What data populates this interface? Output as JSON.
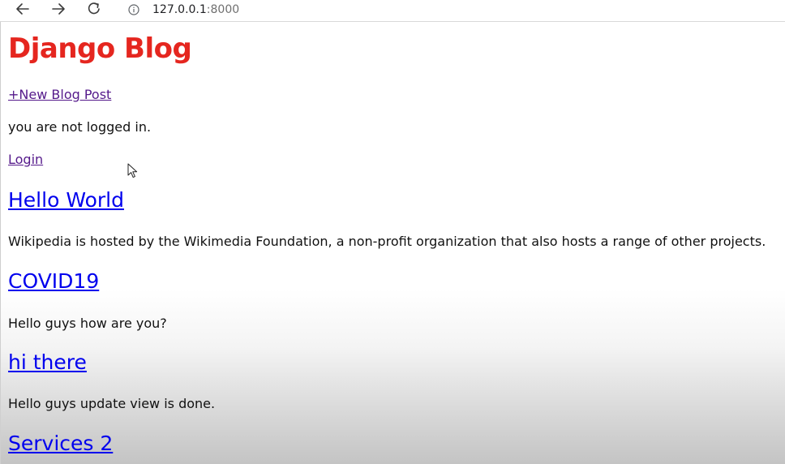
{
  "browser": {
    "url_host": "127.0.0.1",
    "url_port": ":8000",
    "icons": {
      "back": "arrow-left-icon",
      "forward": "arrow-right-icon",
      "reload": "reload-icon",
      "info": "info-icon"
    }
  },
  "page": {
    "blog_title": "Django Blog",
    "new_post_link": "+New Blog Post",
    "status_text": "you are not logged in.",
    "login_link": "Login",
    "title_color": "#e5261f",
    "link_color": "#0000ee",
    "visited_link_color": "#551a8b"
  },
  "posts": [
    {
      "title": "Hello World",
      "body": "Wikipedia is hosted by the Wikimedia Foundation, a non-profit organization that also hosts a range of other projects."
    },
    {
      "title": "COVID19",
      "body": "Hello guys how are you?"
    },
    {
      "title": "hi there",
      "body": "Hello guys update view is done."
    },
    {
      "title": "Services 2"
    }
  ]
}
